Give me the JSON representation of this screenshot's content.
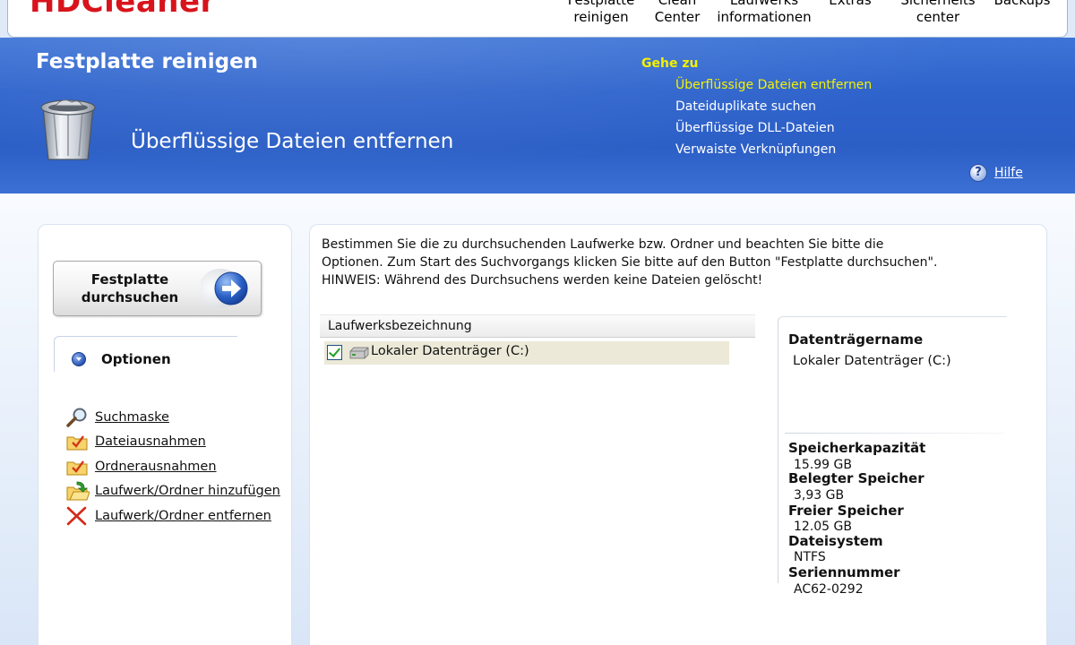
{
  "app": {
    "logo": "HDCleaner"
  },
  "topnav": [
    {
      "label": "Festplatte\nreinigen"
    },
    {
      "label": "Clean\nCenter"
    },
    {
      "label": "Laufwerks\ninformationen"
    },
    {
      "label": "Extras"
    },
    {
      "label": "Sicherheits\ncenter"
    },
    {
      "label": "Backups"
    }
  ],
  "banner": {
    "title": "Festplatte reinigen",
    "subtitle": "Überflüssige Dateien entfernen",
    "goto_title": "Gehe zu",
    "goto_items": [
      {
        "label": "Überflüssige Dateien entfernen",
        "active": true
      },
      {
        "label": "Dateiduplikate suchen",
        "active": false
      },
      {
        "label": "Überflüssige DLL-Dateien",
        "active": false
      },
      {
        "label": "Verwaiste Verknüpfungen",
        "active": false
      }
    ],
    "help_label": "Hilfe",
    "help_icon_glyph": "?",
    "colors": {
      "banner": "#2e63cc",
      "highlight": "#f4f100"
    }
  },
  "left": {
    "search_button_label": "Festplatte\ndurchsuchen",
    "options_label": "Optionen",
    "links": [
      {
        "label": "Suchmaske",
        "icon": "magnifier-icon"
      },
      {
        "label": "Dateiausnahmen",
        "icon": "checked-folder-icon"
      },
      {
        "label": "Ordnerausnahmen",
        "icon": "checked-folder-icon"
      },
      {
        "label": "Laufwerk/Ordner hinzufügen",
        "icon": "add-folder-icon"
      },
      {
        "label": "Laufwerk/Ordner entfernen",
        "icon": "red-x-icon"
      }
    ]
  },
  "main": {
    "intro_lines": [
      "Bestimmen Sie die zu durchsuchenden Laufwerke bzw. Ordner und beachten Sie bitte die",
      "Optionen. Zum Start des Suchvorgangs klicken Sie bitte auf den Button \"Festplatte durchsuchen\".",
      "HINWEIS: Während des Durchsuchens werden keine Dateien gelöscht!"
    ],
    "drive_column_header": "Laufwerksbezeichnung",
    "drives": [
      {
        "label": "Lokaler Datenträger (C:)",
        "checked": true
      }
    ]
  },
  "info": {
    "name_label": "Datenträgername",
    "name_value": "Lokaler Datenträger (C:)",
    "fields": [
      {
        "label": "Speicherkapazität",
        "value": "15.99 GB"
      },
      {
        "label": "Belegter Speicher",
        "value": "3,93 GB"
      },
      {
        "label": "Freier Speicher",
        "value": "12.05 GB"
      },
      {
        "label": "Dateisystem",
        "value": "NTFS"
      },
      {
        "label": "Seriennummer",
        "value": "AC62-0292"
      }
    ]
  }
}
